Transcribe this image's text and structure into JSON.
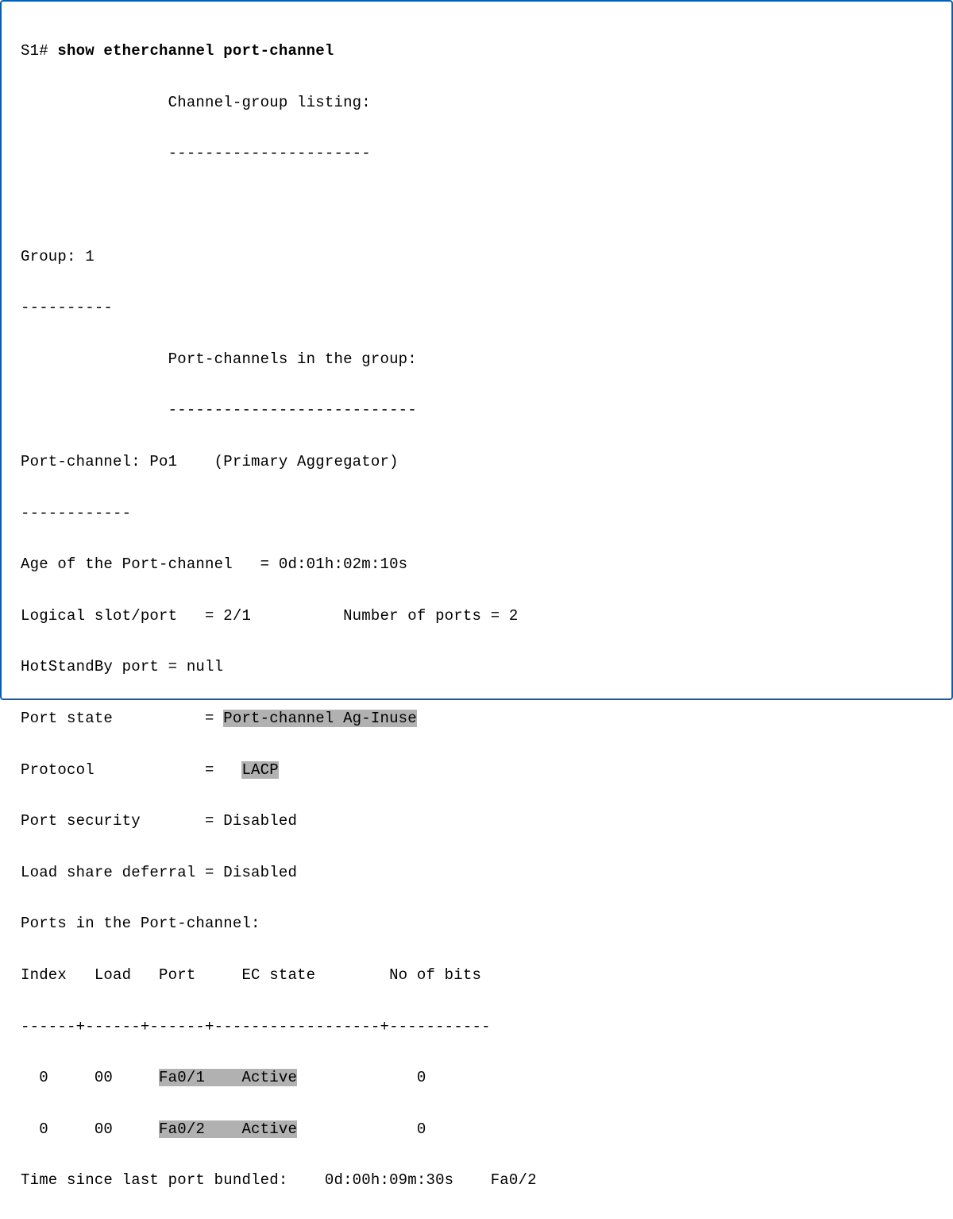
{
  "prompt": "S1# ",
  "command": "show etherchannel port-channel",
  "heading1": "                Channel-group listing:",
  "heading1_ul": "                ----------------------",
  "group_line": "Group: 1",
  "group_ul": "----------",
  "heading2": "                Port-channels in the group:",
  "heading2_ul": "                ---------------------------",
  "pc_line": "Port-channel: Po1    (Primary Aggregator)",
  "pc_ul": "------------",
  "age_line": "Age of the Port-channel   = 0d:01h:02m:10s",
  "logical_line": "Logical slot/port   = 2/1          Number of ports = 2",
  "hotstandby_line": "HotStandBy port = null",
  "portstate_pre": "Port state          = ",
  "portstate_hl": "Port-channel Ag-Inuse",
  "protocol_pre": "Protocol            =   ",
  "protocol_hl": "LACP",
  "portsec_line": "Port security       = Disabled",
  "loadshare_line": "Load share deferral = Disabled",
  "ports_in_pc": "Ports in the Port-channel:",
  "tbl_header": "Index   Load   Port     EC state        No of bits",
  "tbl_ul": "------+------+------+------------------+-----------",
  "row0_pre": "  0     00     ",
  "row0_hl": "Fa0/1    Active",
  "row0_post": "             0",
  "row1_pre": "  0     00     ",
  "row1_hl": "Fa0/2    Active",
  "row1_post": "             0",
  "time_line": "Time since last port bundled:    0d:00h:09m:30s    Fa0/2"
}
